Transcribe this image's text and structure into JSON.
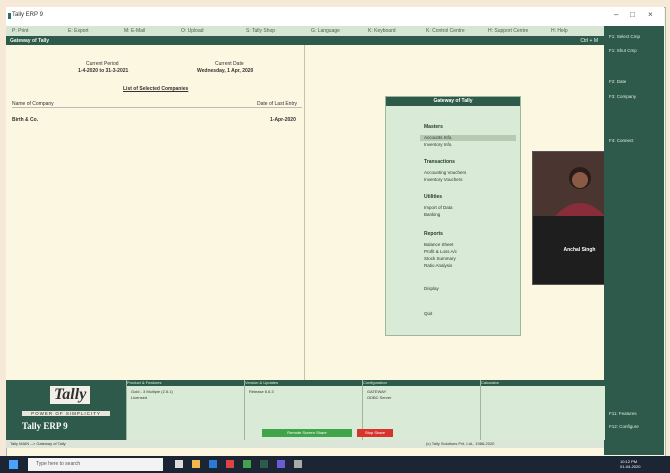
{
  "window": {
    "title": "Tally ERP 9"
  },
  "menubar": [
    "P: Print",
    "E: Export",
    "M: E-Mail",
    "O: Upload",
    "S: Tally Shop",
    "G: Language",
    "K: Keyboard",
    "K: Control Centre",
    "H: Support Centre",
    "H: Help"
  ],
  "gateway": {
    "title": "Gateway of Tally",
    "shortcut": "Ctrl + M"
  },
  "left": {
    "current_period_label": "Current Period",
    "current_period": "1-4-2020 to 31-3-2021",
    "current_date_label": "Current Date",
    "current_date": "Wednesday, 1 Apr, 2020",
    "list_title": "List of Selected Companies",
    "col_name": "Name of Company",
    "col_date": "Date of Last Entry",
    "company": "Birth & Co.",
    "company_date": "1-Apr-2020"
  },
  "menu": {
    "title": "Gateway of Tally",
    "masters": "Masters",
    "masters_items": [
      "Accounts Info.",
      "Inventory Info."
    ],
    "transactions": "Transactions",
    "transactions_items": [
      "Accounting Vouchers",
      "Inventory Vouchers"
    ],
    "utilities": "Utilities",
    "utilities_items": [
      "Import of Data",
      "Banking"
    ],
    "reports": "Reports",
    "reports_items": [
      "Balance Sheet",
      "Profit & Loss A/c",
      "Stock Summary",
      "Ratio Analysis"
    ],
    "display": "Display",
    "quit": "Quit"
  },
  "video": {
    "name": "Anchal Singh"
  },
  "sidebar": [
    "F1: Select Cmp",
    "F1: Shut Cmp",
    "F2: Date",
    "F3: Company",
    "F4: Connect",
    "F11: Features",
    "F12: Configure"
  ],
  "logo": {
    "brand": "Tally",
    "tagline": "POWER OF SIMPLICITY",
    "version": "Tally ERP 9"
  },
  "panels": [
    {
      "title": "Product & Features",
      "text": [
        "Gold - 3 Multiple (2.5.1)",
        "Licensed"
      ]
    },
    {
      "title": "Version & Updates",
      "text": [
        "Release 6.6.3"
      ]
    },
    {
      "title": "Configuration",
      "text": [
        "GATEWAY",
        "ODBC Server"
      ]
    },
    {
      "title": "Calculator",
      "text": []
    }
  ],
  "buttons": {
    "green": "Remote Screen Share",
    "red": "Stop Share"
  },
  "status": {
    "left": "Tally MAIN --> Gateway of Tally",
    "right": "(c) Tally Solutions Pvt. Ltd., 1988-2020"
  },
  "taskbar": {
    "search": "Type here to search",
    "time": "10:12 PM",
    "date": "01-04-2020"
  },
  "colors": {
    "tally_dark": "#2e5a4b",
    "tally_light": "#d9ead6",
    "cream": "#fbf7e1"
  }
}
